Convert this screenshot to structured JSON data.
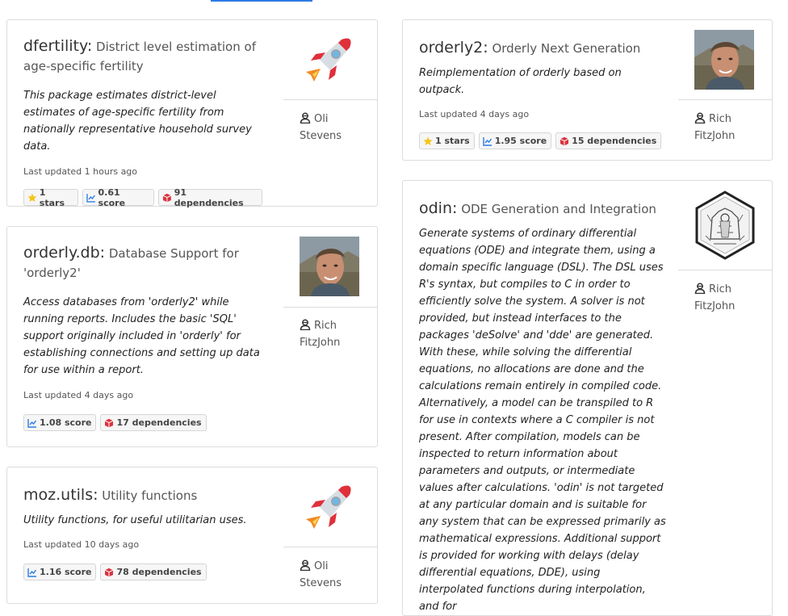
{
  "cards": [
    {
      "name": "dfertility:",
      "tagline": "District level estimation of age-specific fertility",
      "description": "This package estimates district-level estimates of age-specific fertility from nationally representative household survey data.",
      "updated": "Last updated 1 hours ago",
      "badges": {
        "stars": "1 stars",
        "score": "0.61 score",
        "deps": "91 dependencies"
      },
      "author": "Oli Stevens",
      "avatar": "rocket-icon"
    },
    {
      "name": "orderly.db:",
      "tagline": "Database Support for 'orderly2'",
      "description": "Access databases from 'orderly2' while running reports. Includes the basic 'SQL' support originally included in 'orderly' for establishing connections and setting up data for use within a report.",
      "updated": "Last updated 4 days ago",
      "badges": {
        "score": "1.08 score",
        "deps": "17 dependencies"
      },
      "author": "Rich FitzJohn",
      "avatar": "photo"
    },
    {
      "name": "moz.utils:",
      "tagline": "Utility functions",
      "description": "Utility functions, for useful utilitarian uses.",
      "updated": "Last updated 10 days ago",
      "badges": {
        "score": "1.16 score",
        "deps": "78 dependencies"
      },
      "author": "Oli Stevens",
      "avatar": "rocket-icon"
    },
    {
      "name": "orderly2:",
      "tagline": "Orderly Next Generation",
      "description": "Reimplementation of orderly based on outpack.",
      "updated": "Last updated 4 days ago",
      "badges": {
        "stars": "1 stars",
        "score": "1.95 score",
        "deps": "15 dependencies"
      },
      "author": "Rich FitzJohn",
      "avatar": "photo"
    },
    {
      "name": "odin:",
      "tagline": "ODE Generation and Integration",
      "description": "Generate systems of ordinary differential equations (ODE) and integrate them, using a domain specific language (DSL). The DSL uses R's syntax, but compiles to C in order to efficiently solve the system. A solver is not provided, but instead interfaces to the packages 'deSolve' and 'dde' are generated. With these, while solving the differential equations, no allocations are done and the calculations remain entirely in compiled code. Alternatively, a model can be transpiled to R for use in contexts where a C compiler is not present. After compilation, models can be inspected to return information about parameters and outputs, or intermediate values after calculations. 'odin' is not targeted at any particular domain and is suitable for any system that can be expressed primarily as mathematical expressions. Additional support is provided for working with delays (delay differential equations, DDE), using interpolated functions during interpolation, and for",
      "author": "Rich FitzJohn",
      "avatar": "hexagon-logo"
    }
  ],
  "colors": {
    "accent": "#2c7be5",
    "star": "#f5c518",
    "deps": "#d9333f"
  }
}
